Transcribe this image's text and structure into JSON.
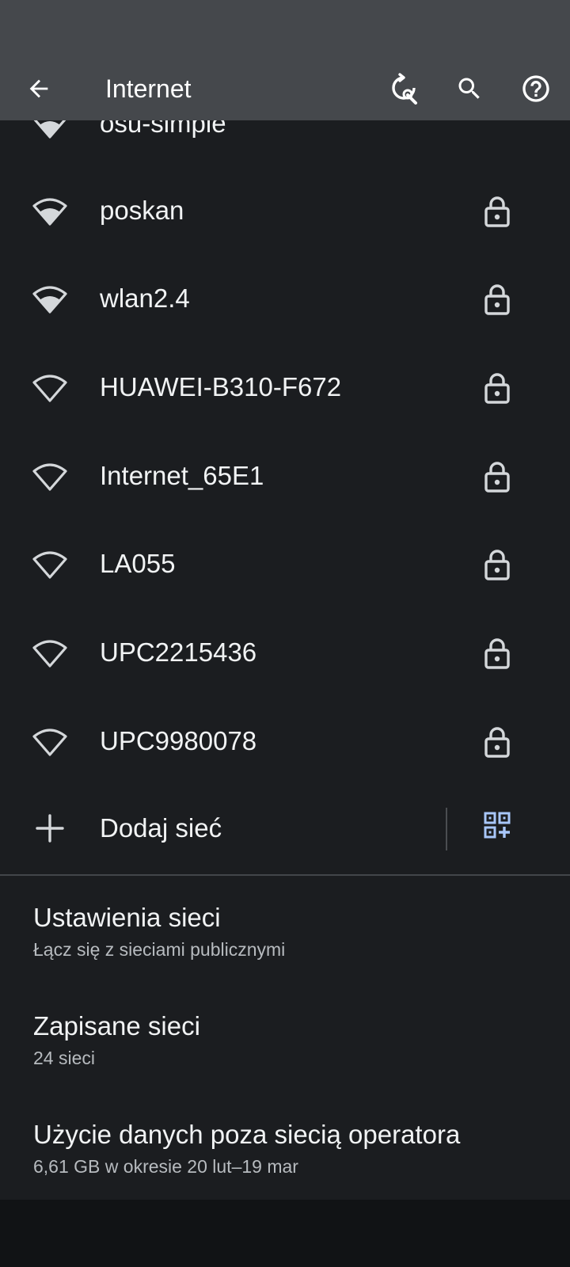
{
  "header": {
    "title": "Internet",
    "back_icon": "arrow-left-icon",
    "actions": [
      "wifi-repair-icon",
      "search-icon",
      "help-icon"
    ]
  },
  "networks": [
    {
      "name": "osu-simple",
      "secured": false,
      "signal": "strong"
    },
    {
      "name": "poskan",
      "secured": true,
      "signal": "strong"
    },
    {
      "name": "wlan2.4",
      "secured": true,
      "signal": "strong"
    },
    {
      "name": "HUAWEI-B310-F672",
      "secured": true,
      "signal": "weak"
    },
    {
      "name": "Internet_65E1",
      "secured": true,
      "signal": "weak"
    },
    {
      "name": "LA055",
      "secured": true,
      "signal": "weak"
    },
    {
      "name": "UPC2215436",
      "secured": true,
      "signal": "weak"
    },
    {
      "name": "UPC9980078",
      "secured": true,
      "signal": "weak"
    }
  ],
  "add_network": {
    "label": "Dodaj sieć",
    "icon": "plus-icon",
    "qr_icon": "qr-scan-icon"
  },
  "settings": [
    {
      "title": "Ustawienia sieci",
      "subtitle": "Łącz się z sieciami publicznymi"
    },
    {
      "title": "Zapisane sieci",
      "subtitle": "24 sieci"
    },
    {
      "title": "Użycie danych poza siecią operatora",
      "subtitle": "6,61 GB w okresie 20 lut–19 mar"
    }
  ],
  "colors": {
    "app_bar": "#45484c",
    "background": "#1b1d20",
    "accent_icon": "#a8c7fa",
    "text_primary": "#f1f3f4",
    "text_secondary": "#b7bbbf"
  }
}
